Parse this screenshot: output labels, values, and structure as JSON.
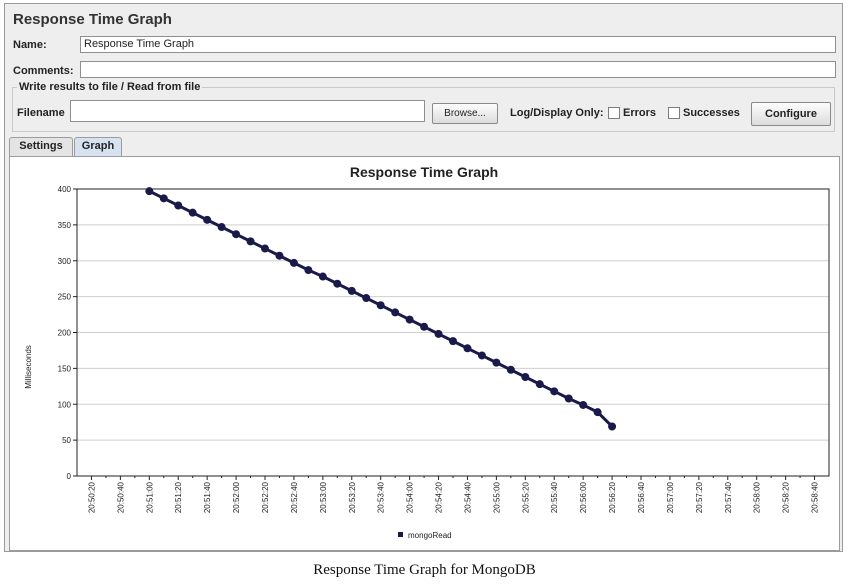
{
  "window": {
    "title": "Response Time Graph",
    "name_label": "Name:",
    "name_value": "Response Time Graph",
    "comments_label": "Comments:",
    "comments_value": "",
    "group_title": "Write results to file / Read from file",
    "filename_label": "Filename",
    "filename_value": "",
    "browse_label": "Browse...",
    "log_display_label": "Log/Display Only:",
    "errors_label": "Errors",
    "errors_checked": false,
    "successes_label": "Successes",
    "successes_checked": false,
    "configure_label": "Configure",
    "tabs": [
      {
        "label": "Settings",
        "active": false
      },
      {
        "label": "Graph",
        "active": true
      }
    ]
  },
  "chart_data": {
    "type": "line",
    "title": "Response Time Graph",
    "xlabel": "",
    "ylabel": "Milliseconds",
    "ylim": [
      0,
      400
    ],
    "yticks": [
      0,
      50,
      100,
      150,
      200,
      250,
      300,
      350,
      400
    ],
    "xticks": [
      "20:50:20",
      "20:50:40",
      "20:51:00",
      "20:51:20",
      "20:51:40",
      "20:52:00",
      "20:52:20",
      "20:52:40",
      "20:53:00",
      "20:53:20",
      "20:53:40",
      "20:54:00",
      "20:54:20",
      "20:54:40",
      "20:55:00",
      "20:55:20",
      "20:55:40",
      "20:56:00",
      "20:56:20",
      "20:56:40",
      "20:57:00",
      "20:57:20",
      "20:57:40",
      "20:58:00",
      "20:58:20",
      "20:58:40"
    ],
    "grid": true,
    "legend": "bottom-center",
    "series": [
      {
        "name": "mongoRead",
        "color": "#1a1a4a",
        "x": [
          "20:51:00",
          "20:51:10",
          "20:51:20",
          "20:51:30",
          "20:51:40",
          "20:51:50",
          "20:52:00",
          "20:52:10",
          "20:52:20",
          "20:52:30",
          "20:52:40",
          "20:52:50",
          "20:53:00",
          "20:53:10",
          "20:53:20",
          "20:53:30",
          "20:53:40",
          "20:53:50",
          "20:54:00",
          "20:54:10",
          "20:54:20",
          "20:54:30",
          "20:54:40",
          "20:54:50",
          "20:55:00",
          "20:55:10",
          "20:55:20",
          "20:55:30",
          "20:55:40",
          "20:55:50",
          "20:56:00",
          "20:56:10",
          "20:56:20"
        ],
        "values": [
          397,
          387,
          377,
          367,
          357,
          347,
          337,
          327,
          317,
          307,
          297,
          287,
          278,
          268,
          258,
          248,
          238,
          228,
          218,
          208,
          198,
          188,
          178,
          168,
          158,
          148,
          138,
          128,
          118,
          108,
          99,
          89,
          69
        ]
      }
    ]
  },
  "caption": "Response Time Graph for MongoDB"
}
